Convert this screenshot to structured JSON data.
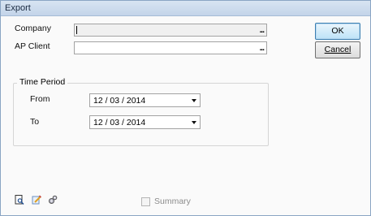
{
  "window": {
    "title": "Export"
  },
  "fields": {
    "company": {
      "label": "Company",
      "value": "",
      "browse": "..."
    },
    "ap_client": {
      "label": "AP Client",
      "value": "",
      "browse": "..."
    }
  },
  "buttons": {
    "ok": "OK",
    "cancel": "Cancel"
  },
  "time_period": {
    "title": "Time Period",
    "from": {
      "label": "From",
      "value": "12 / 03 / 2014"
    },
    "to": {
      "label": "To",
      "value": "12 / 03 / 2014"
    }
  },
  "toolbar": {
    "icons": [
      "preview-icon",
      "edit-icon",
      "settings-icon"
    ]
  },
  "summary": {
    "label": "Summary",
    "checked": false,
    "enabled": false
  }
}
